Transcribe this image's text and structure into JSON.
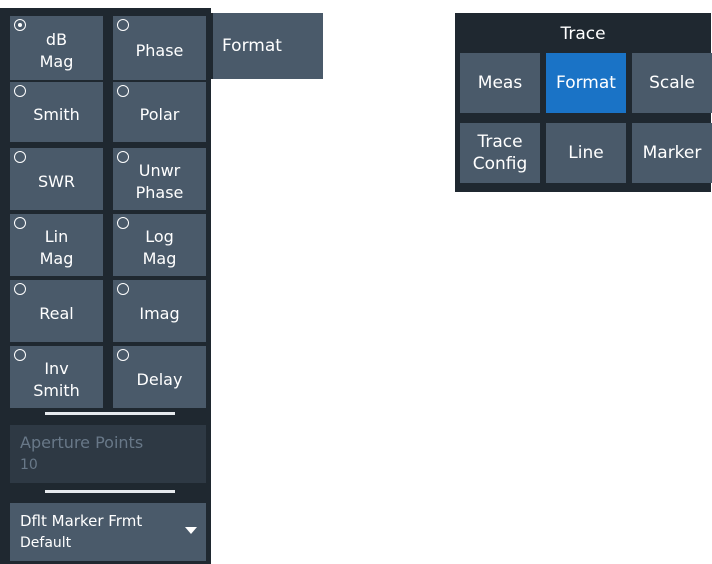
{
  "format_panel": {
    "buttons": [
      {
        "label": "dB\nMag",
        "selected": true
      },
      {
        "label": "Phase",
        "selected": false
      },
      {
        "label": "Smith",
        "selected": false
      },
      {
        "label": "Polar",
        "selected": false
      },
      {
        "label": "SWR",
        "selected": false
      },
      {
        "label": "Unwr\nPhase",
        "selected": false
      },
      {
        "label": "Lin\nMag",
        "selected": false
      },
      {
        "label": "Log\nMag",
        "selected": false
      },
      {
        "label": "Real",
        "selected": false
      },
      {
        "label": "Imag",
        "selected": false
      },
      {
        "label": "Inv\nSmith",
        "selected": false
      },
      {
        "label": "Delay",
        "selected": false
      }
    ],
    "aperture": {
      "label": "Aperture Points",
      "value": "10"
    },
    "marker_format": {
      "label": "Dflt Marker Frmt",
      "value": "Default"
    },
    "tab_label": "Format"
  },
  "trace_menu": {
    "title": "Trace",
    "buttons": [
      {
        "label": "Meas",
        "active": false
      },
      {
        "label": "Format",
        "active": true
      },
      {
        "label": "Scale",
        "active": false
      },
      {
        "label": "Trace\nConfig",
        "active": false
      },
      {
        "label": "Line",
        "active": false
      },
      {
        "label": "Marker",
        "active": false
      }
    ]
  },
  "colors": {
    "panel_bg": "#1f2830",
    "button_bg": "#4a5a6a",
    "active_bg": "#1a73c6",
    "disabled_text": "#687888"
  }
}
